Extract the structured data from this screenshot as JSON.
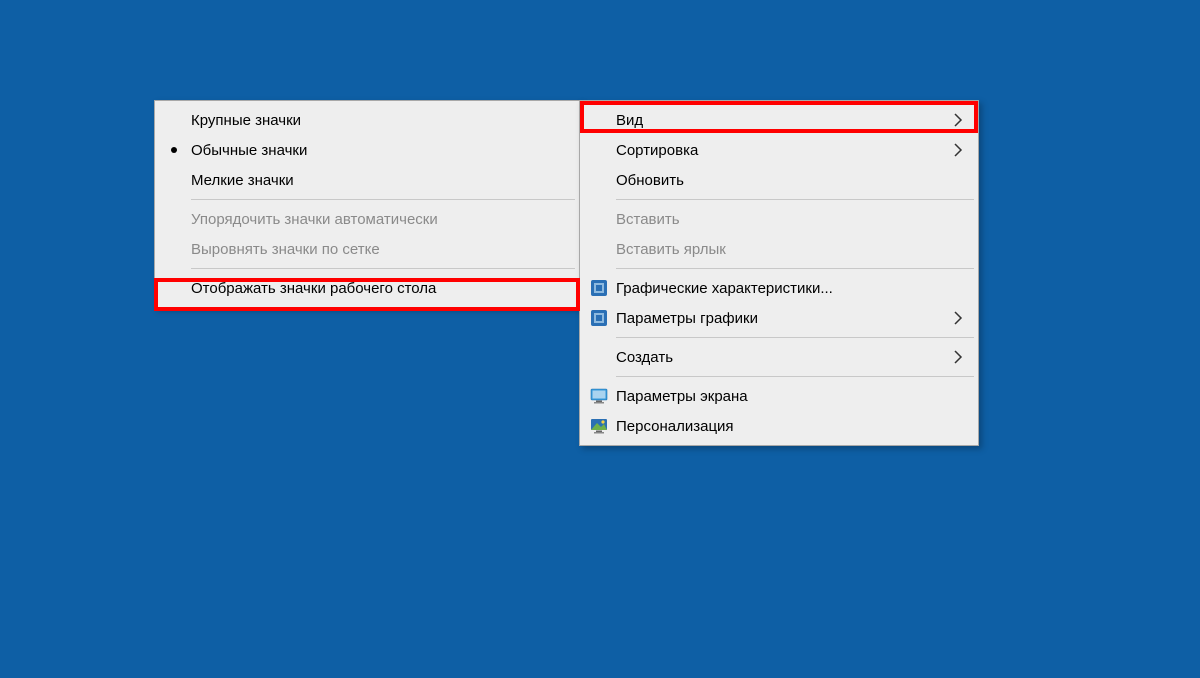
{
  "submenu": {
    "items": [
      {
        "label": "Крупные значки"
      },
      {
        "label": "Обычные значки"
      },
      {
        "label": "Мелкие значки"
      },
      {
        "label": "Упорядочить значки автоматически"
      },
      {
        "label": "Выровнять значки по сетке"
      },
      {
        "label": "Отображать значки рабочего стола"
      }
    ]
  },
  "mainmenu": {
    "items": [
      {
        "label": "Вид"
      },
      {
        "label": "Сортировка"
      },
      {
        "label": "Обновить"
      },
      {
        "label": "Вставить"
      },
      {
        "label": "Вставить ярлык"
      },
      {
        "label": "Графические характеристики..."
      },
      {
        "label": "Параметры графики"
      },
      {
        "label": "Создать"
      },
      {
        "label": "Параметры экрана"
      },
      {
        "label": "Персонализация"
      }
    ]
  }
}
